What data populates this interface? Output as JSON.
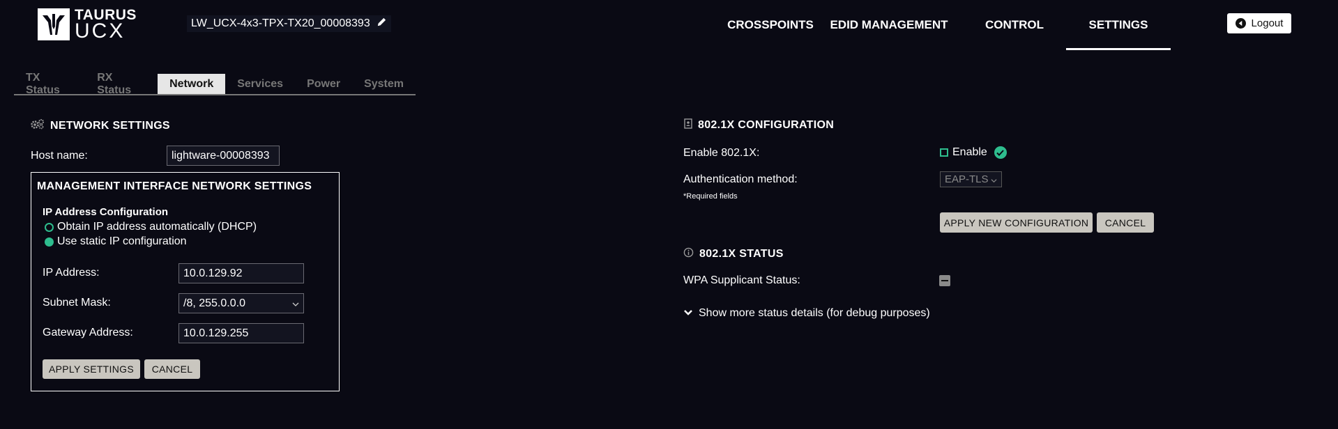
{
  "brand": {
    "line1": "TAURUS",
    "line2": "UCX"
  },
  "device": {
    "name": "LW_UCX-4x3-TPX-TX20_00008393"
  },
  "nav": {
    "crosspoints": "CROSSPOINTS",
    "edid": "EDID MANAGEMENT",
    "control": "CONTROL",
    "settings": "SETTINGS",
    "active": "SETTINGS"
  },
  "logout": {
    "label": "Logout"
  },
  "tabs": {
    "tx_status": "TX Status",
    "rx_status": "RX Status",
    "network": "Network",
    "services": "Services",
    "power": "Power",
    "system": "System",
    "active": "Network"
  },
  "network": {
    "title": "NETWORK SETTINGS",
    "host_label": "Host name:",
    "host_value": "lightware-00008393",
    "mgmt": {
      "title": "MANAGEMENT INTERFACE NETWORK SETTINGS",
      "ip_config_title": "IP Address Configuration",
      "dhcp_label": "Obtain IP address automatically (DHCP)",
      "static_label": "Use static IP configuration",
      "selected": "static",
      "ip_label": "IP Address:",
      "ip_value": "10.0.129.92",
      "subnet_label": "Subnet Mask:",
      "subnet_value": "/8, 255.0.0.0",
      "gateway_label": "Gateway Address:",
      "gateway_value": "10.0.129.255",
      "apply_label": "APPLY SETTINGS",
      "cancel_label": "CANCEL"
    }
  },
  "dot1x": {
    "title": "802.1X CONFIGURATION",
    "enable_label": "Enable 802.1X:",
    "enable_checkbox_label": "Enable",
    "enabled": false,
    "auth_label": "Authentication method:",
    "auth_value": "EAP-TLS",
    "required_note": "*Required fields",
    "apply_label": "APPLY NEW CONFIGURATION",
    "cancel_label": "CANCEL"
  },
  "dot1x_status": {
    "title": "802.1X STATUS",
    "wpa_label": "WPA Supplicant Status:",
    "more_label": "Show more status details (for debug purposes)"
  },
  "colors": {
    "background": "#0a0a14",
    "accent_green": "#2ebd8e",
    "button_bg": "#c9c6bf",
    "tab_active_bg": "#e6e6e6"
  }
}
